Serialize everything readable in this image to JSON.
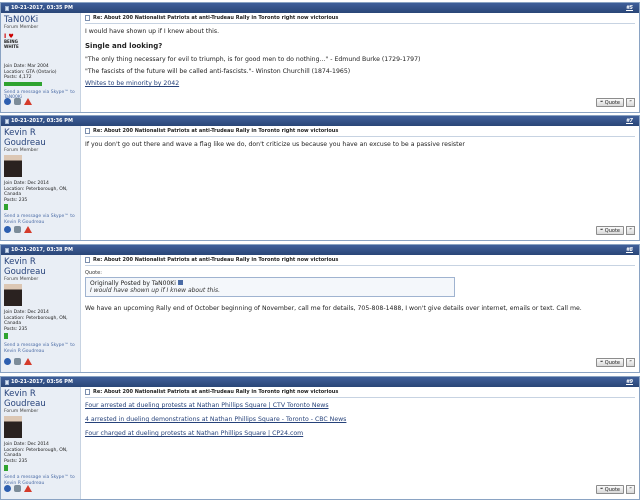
{
  "posts": [
    {
      "date": "10-21-2017, 03:35 PM",
      "number": "#5",
      "username": "TaN00Ki",
      "user_title": "Forum Member",
      "avatar": "i-heart-being-white-badge",
      "avatar_text": [
        "I ♥",
        "BEING",
        "WHITE"
      ],
      "join_date": "Join Date: Mar 2004",
      "location": "Location: GTA (Ontario)",
      "posts_count": "Posts: 4,172",
      "skype": "Send a message via Skype™ to TaN00Ki",
      "post_title": "Re: About 200 Nationalist Patriots at anti-Trudeau Rally in Toronto right now victorious",
      "lines": [
        "I would have shown up if I knew about this.",
        "Single and looking?",
        "\"The only thing necessary for evil to triumph, is for good men to do nothing...\" - Edmund Burke (1729-1797)",
        "\"The fascists of the future will be called anti-fascists.\"- Winston Churchill (1874-1965)",
        "Whites to be minority by 2042"
      ]
    },
    {
      "date": "10-21-2017, 03:36 PM",
      "number": "#7",
      "username": "Kevin R Goudreau",
      "user_title": "Forum Member",
      "join_date": "Join Date: Dec 2014",
      "location": "Location: Peterborough, ON, Canada",
      "posts_count": "Posts: 235",
      "skype": "Send a message via Skype™ to Kevin R Goudreau",
      "post_title": "Re: About 200 Nationalist Patriots at anti-Trudeau Rally in Toronto right now victorious",
      "lines": [
        "If you don't go out there and wave a flag like we do, don't criticize us because you have an excuse to be a passive resister"
      ]
    },
    {
      "date": "10-21-2017, 03:38 PM",
      "number": "#8",
      "username": "Kevin R Goudreau",
      "user_title": "Forum Member",
      "join_date": "Join Date: Dec 2014",
      "location": "Location: Peterborough, ON, Canada",
      "posts_count": "Posts: 235",
      "skype": "Send a message via Skype™ to Kevin R Goudreau",
      "post_title": "Re: About 200 Nationalist Patriots at anti-Trudeau Rally in Toronto right now victorious",
      "quote_label": "Quote:",
      "quote_by": "Originally Posted by TaN00Ki",
      "quote_text": "I would have shown up if I knew about this.",
      "lines": [
        "We have an upcoming Rally end of October beginning of November, call me for details, 705-808-1488, I won't give details over internet, emails or text. Call me."
      ]
    },
    {
      "date": "10-21-2017, 03:56 PM",
      "number": "#9",
      "username": "Kevin R Goudreau",
      "user_title": "Forum Member",
      "join_date": "Join Date: Dec 2014",
      "location": "Location: Peterborough, ON, Canada",
      "posts_count": "Posts: 235",
      "skype": "Send a message via Skype™ to Kevin R Goudreau",
      "post_title": "Re: About 200 Nationalist Patriots at anti-Trudeau Rally in Toronto right now victorious",
      "links": [
        "Four arrested at dueling protests at Nathan Phillips Square | CTV Toronto News",
        "4 arrested in dueling demonstrations at Nathan Phillips Square - Toronto - CBC News",
        "Four charged at dueling protests at Nathan Phillips Square | CP24.com"
      ]
    }
  ],
  "buttons": {
    "quote_label": "Quote"
  },
  "colors": {
    "header": "#2f4f87",
    "sidebar": "#e9eef5",
    "link": "#26427a",
    "rep": "#2fa32f"
  }
}
